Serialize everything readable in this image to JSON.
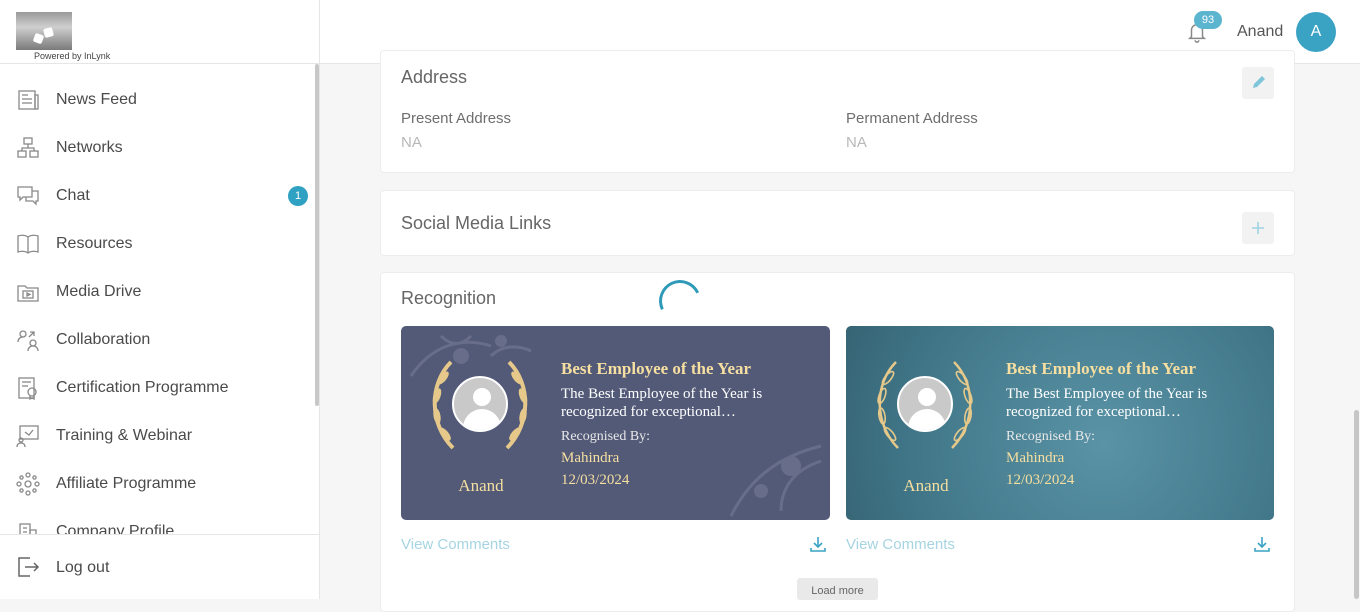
{
  "brand": {
    "powered_by": "Powered by InLynk"
  },
  "sidebar": {
    "items": [
      {
        "label": "News Feed",
        "icon": "news-feed-icon"
      },
      {
        "label": "Networks",
        "icon": "networks-icon"
      },
      {
        "label": "Chat",
        "icon": "chat-icon",
        "badge": "1"
      },
      {
        "label": "Resources",
        "icon": "book-icon"
      },
      {
        "label": "Media Drive",
        "icon": "media-drive-icon"
      },
      {
        "label": "Collaboration",
        "icon": "collaboration-icon"
      },
      {
        "label": "Certification Programme",
        "icon": "certificate-icon"
      },
      {
        "label": "Training & Webinar",
        "icon": "training-icon"
      },
      {
        "label": "Affiliate Programme",
        "icon": "affiliate-icon"
      },
      {
        "label": "Company Profile",
        "icon": "building-icon"
      }
    ],
    "logout_label": "Log out"
  },
  "header": {
    "notification_count": "93",
    "user_name": "Anand",
    "avatar_initial": "A"
  },
  "address": {
    "title": "Address",
    "present_label": "Present Address",
    "present_value": "NA",
    "permanent_label": "Permanent Address",
    "permanent_value": "NA"
  },
  "social": {
    "title": "Social Media Links"
  },
  "recognition": {
    "title": "Recognition",
    "cards": [
      {
        "name": "Anand",
        "title": "Best Employee of the Year",
        "desc_line1": "The Best Employee of the Year is",
        "desc_line2": "recognized for exceptional…",
        "by_label": "Recognised By:",
        "recognizer": "Mahindra",
        "date": "12/03/2024",
        "view_comments": "View Comments"
      },
      {
        "name": "Anand",
        "title": "Best Employee of the Year",
        "desc_line1": "The Best Employee of the Year is",
        "desc_line2": "recognized for exceptional…",
        "by_label": "Recognised By:",
        "recognizer": "Mahindra",
        "date": "12/03/2024",
        "view_comments": "View Comments"
      }
    ],
    "load_more": "Load more"
  },
  "colors": {
    "accent": "#2fa1c3",
    "card_one_bg": "#525a78",
    "card_two_bg": "#4a8497",
    "gold": "#f6dfa0"
  }
}
